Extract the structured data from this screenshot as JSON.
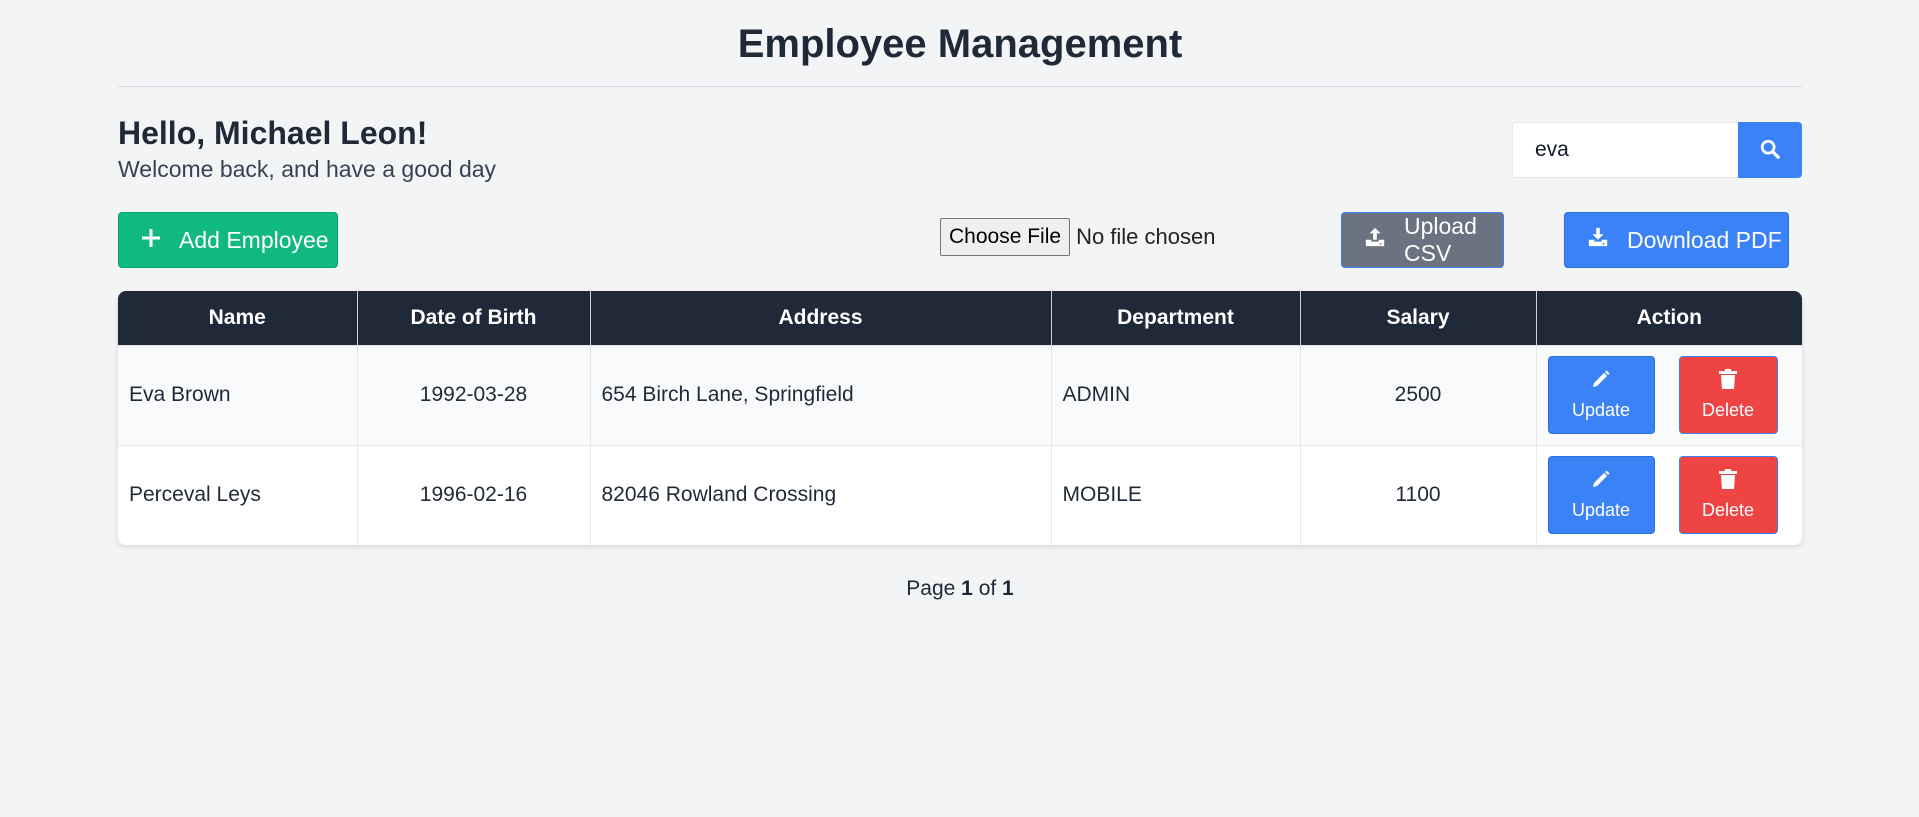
{
  "page": {
    "title": "Employee Management"
  },
  "greeting": {
    "title": "Hello, Michael Leon!",
    "subtitle": "Welcome back, and have a good day"
  },
  "search": {
    "value": "eva",
    "icon": "search-icon"
  },
  "toolbar": {
    "add_label": "Add Employee",
    "file_button_label": "Choose File",
    "file_status": "No file chosen",
    "upload_label": "Upload CSV",
    "download_label": "Download PDF"
  },
  "table": {
    "headers": [
      "Name",
      "Date of Birth",
      "Address",
      "Department",
      "Salary",
      "Action"
    ],
    "rows": [
      {
        "name": "Eva Brown",
        "dob": "1992-03-28",
        "address": "654 Birch Lane, Springfield",
        "department": "ADMIN",
        "salary": "2500"
      },
      {
        "name": "Perceval Leys",
        "dob": "1996-02-16",
        "address": "82046 Rowland Crossing",
        "department": "MOBILE",
        "salary": "1100"
      }
    ],
    "update_label": "Update",
    "delete_label": "Delete"
  },
  "pagination": {
    "prefix": "Page",
    "current": "1",
    "separator": "of",
    "total": "1"
  },
  "colors": {
    "add": "#10b981",
    "primary": "#3b82f6",
    "upload": "#6b7280",
    "danger": "#ef4444",
    "header": "#1f2937",
    "background": "#f3f4f6"
  }
}
